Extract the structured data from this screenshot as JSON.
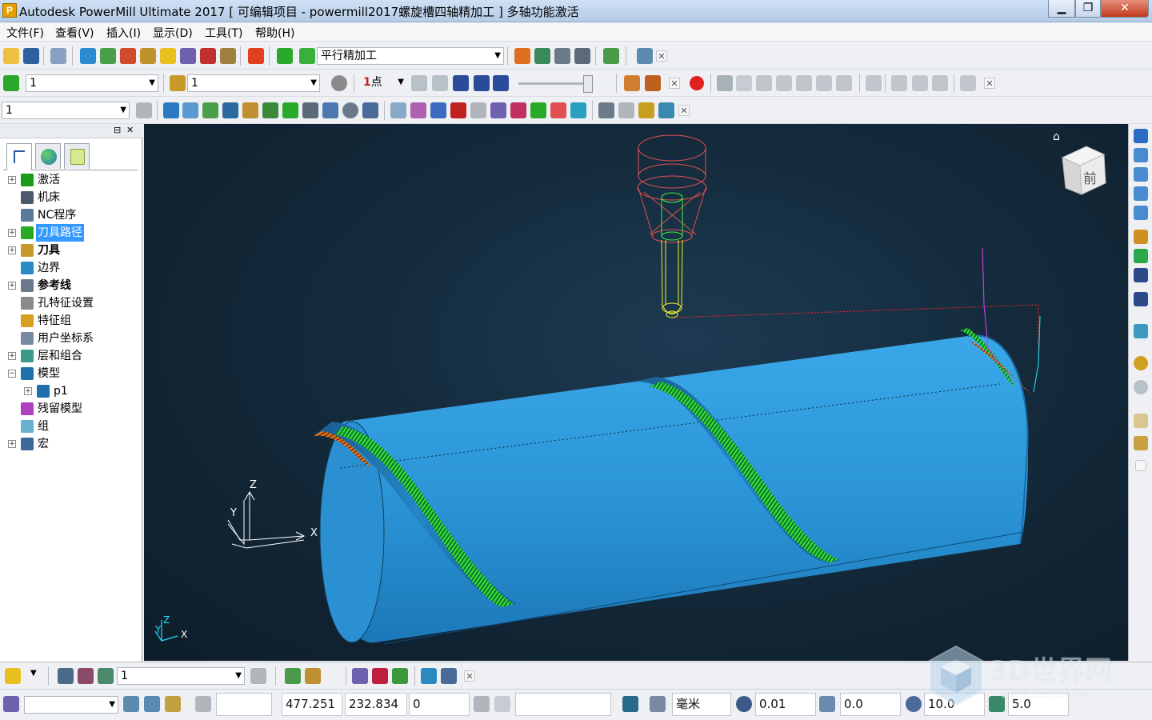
{
  "window": {
    "app_icon_letter": "P",
    "title": "Autodesk PowerMill Ultimate 2017    [ 可编辑项目 - powermill2017螺旋槽四轴精加工 ]    多轴功能激活",
    "min_glyph": "▁",
    "max_glyph": "❐",
    "close_glyph": "✕"
  },
  "menu": [
    "文件(F)",
    "查看(V)",
    "插入(I)",
    "显示(D)",
    "工具(T)",
    "帮助(H)"
  ],
  "toolbar1": {
    "strategy_label": "平行精加工",
    "combo_arrow": "▼",
    "close_glyph": "✕"
  },
  "toolbar2": {
    "toolpath_value": "1",
    "tool_value": "1",
    "point_mode": "点",
    "point_prefix": "1",
    "combo_arrow": "▼",
    "close_glyph": "✕"
  },
  "toolbar3": {
    "level_value": "1",
    "combo_arrow": "▼",
    "close_glyph": "✕"
  },
  "explorer": {
    "pin_glyph": "⊟",
    "close_glyph": "✕",
    "items": [
      {
        "label": "激活",
        "expander": "+",
        "icon": "activate-icon",
        "color": "#1a9a1a"
      },
      {
        "label": "机床",
        "expander": "",
        "icon": "machine-icon",
        "color": "#4a5a6a"
      },
      {
        "label": "NC程序",
        "expander": "",
        "icon": "nc-program-icon",
        "color": "#5a7a9a"
      },
      {
        "label": "刀具路径",
        "expander": "+",
        "icon": "toolpath-icon",
        "color": "#2aa82a",
        "selected": true
      },
      {
        "label": "刀具",
        "expander": "+",
        "icon": "tool-icon",
        "color": "#c89a2a",
        "bold": true
      },
      {
        "label": "边界",
        "expander": "",
        "icon": "boundary-icon",
        "color": "#2a8ac8"
      },
      {
        "label": "参考线",
        "expander": "+",
        "icon": "pattern-icon",
        "color": "#6a7a8a",
        "bold": true
      },
      {
        "label": "孔特征设置",
        "expander": "",
        "icon": "hole-feature-icon",
        "color": "#8a8a8a"
      },
      {
        "label": "特征组",
        "expander": "",
        "icon": "feature-group-icon",
        "color": "#d8a020"
      },
      {
        "label": "用户坐标系",
        "expander": "",
        "icon": "workplane-icon",
        "color": "#7a8aa0"
      },
      {
        "label": "层和组合",
        "expander": "+",
        "icon": "levels-icon",
        "color": "#3a9a8a"
      },
      {
        "label": "模型",
        "expander": "−",
        "icon": "model-icon",
        "color": "#1f6fa8"
      },
      {
        "label": "p1",
        "expander": "+",
        "icon": "model-part-icon",
        "color": "#1f6fa8",
        "indent": true
      },
      {
        "label": "残留模型",
        "expander": "",
        "icon": "stock-model-icon",
        "color": "#b040c0"
      },
      {
        "label": "组",
        "expander": "",
        "icon": "group-icon",
        "color": "#6ab0d0"
      },
      {
        "label": "宏",
        "expander": "+",
        "icon": "macro-icon",
        "color": "#3a6a9a"
      }
    ]
  },
  "viewport": {
    "view_cube_label": "前",
    "home_glyph": "⌂",
    "axis_labels": {
      "x": "X",
      "y": "Y",
      "z": "Z"
    },
    "mini_axis_labels": {
      "x": "X",
      "y": "Y",
      "z": "Z"
    },
    "colors": {
      "cylinder": "#2a94d6",
      "toolpath": "#3ef33e",
      "holder": "#e05050",
      "tool_shank": "#f0f028",
      "lead_in": "#ff8a1a",
      "rapid": "#ff2020"
    }
  },
  "bottom_toolbar": {
    "value": "1",
    "combo_arrow": "▼",
    "close_glyph": "✕"
  },
  "status": {
    "x": "477.251",
    "y": "232.834",
    "z": "0",
    "units": "毫米",
    "tolerance": "0.01",
    "thickness": "0.0",
    "diameter": "10.0",
    "stepover": "5.0",
    "combo_arrow": "▼"
  },
  "watermark": {
    "text": "3D世界网",
    "sub": "WWW.3DSJW.COM"
  }
}
